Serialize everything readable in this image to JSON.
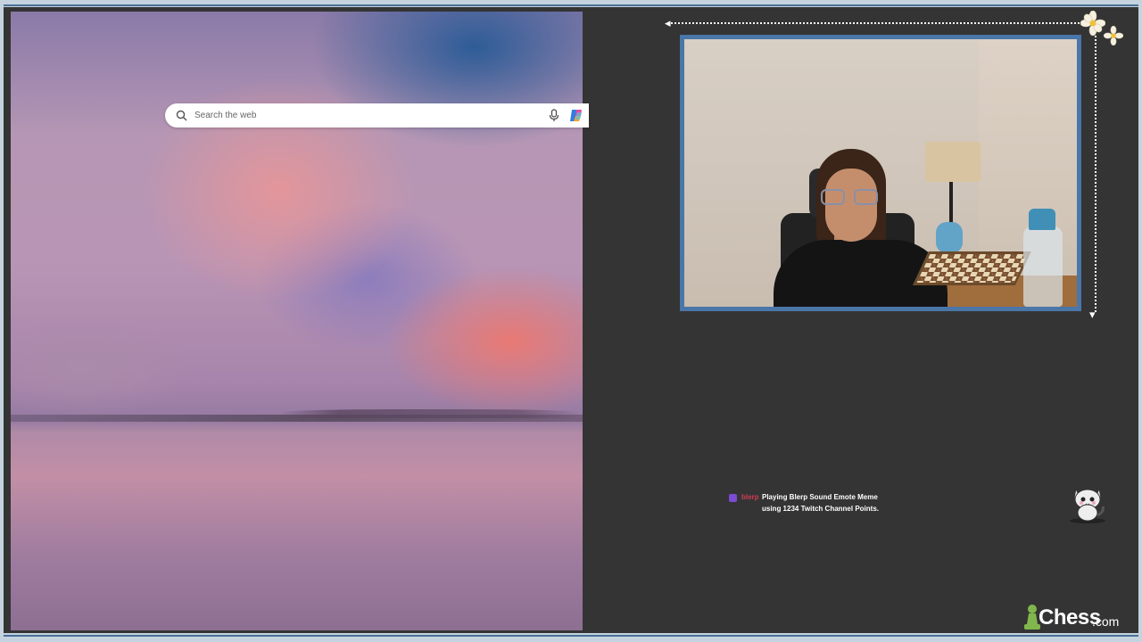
{
  "browser": {
    "search": {
      "placeholder": "Search the web"
    },
    "icons": {
      "search": "search-icon",
      "mic": "microphone-icon",
      "copilot": "copilot-icon"
    }
  },
  "overlay": {
    "alert": {
      "username": "blerp",
      "line1": "Playing Blerp Sound Emote Meme",
      "line2": "using 1234 Twitch Channel Points."
    },
    "brand": {
      "name": "Chess",
      "suffix": ".com"
    },
    "colors": {
      "frame": "#4a76a8",
      "background": "#343434",
      "alert_user": "#cf3c52",
      "brand_green": "#81b64c"
    }
  }
}
